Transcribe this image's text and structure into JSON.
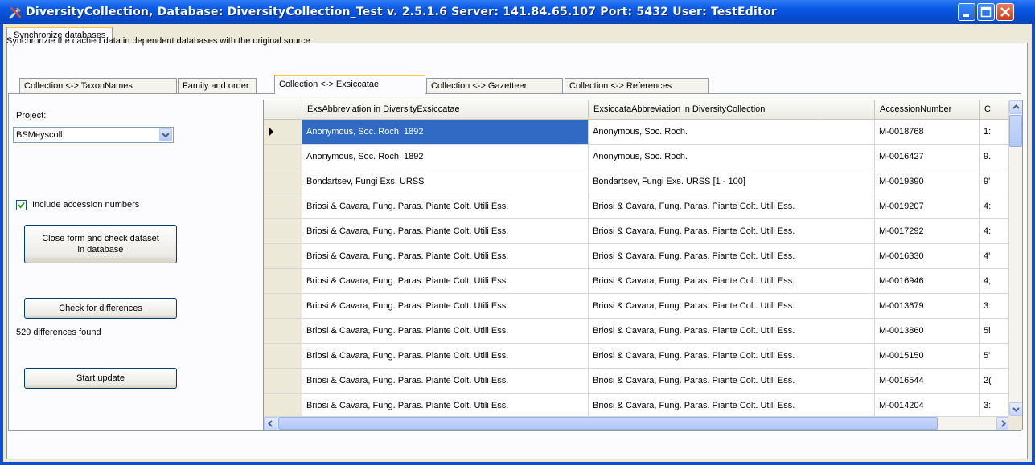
{
  "window": {
    "title": "DiversityCollection,  Database: DiversityCollection_Test   v. 2.5.1.6   Server: 141.84.65.107   Port: 5432   User: TestEditor"
  },
  "main_tab": "Synchronize databases",
  "instruction": "Synchronzie the cached data in dependent databases with the original source",
  "sub_tabs": [
    "Collection <-> TaxonNames",
    "Family and order",
    "Collection <-> Exsiccatae",
    "Collection <-> Gazetteer",
    "Collection <-> References"
  ],
  "left": {
    "project_label": "Project:",
    "project_value": "BSMeyscoll",
    "include_accession_label": "Include accession numbers",
    "include_accession_checked": true,
    "close_check_button": "Close form and check dataset in database",
    "check_diff_button": "Check for differences",
    "diff_status": "529 differences found",
    "start_update_button": "Start update"
  },
  "grid": {
    "columns": [
      "ExsAbbreviation in DiversityExsiccatae",
      "ExsiccataAbbreviation in DiversityCollection",
      "AccessionNumber",
      "C"
    ],
    "rows": [
      [
        "Anonymous, Soc. Roch. 1892",
        "Anonymous, Soc. Roch.",
        "M-0018768",
        "1:"
      ],
      [
        "Anonymous, Soc. Roch. 1892",
        "Anonymous, Soc. Roch.",
        "M-0016427",
        "9."
      ],
      [
        "Bondartsev, Fungi Exs. URSS",
        "Bondartsev, Fungi Exs. URSS [1 - 100]",
        "M-0019390",
        "9'"
      ],
      [
        "Briosi & Cavara, Fung. Paras. Piante Colt. Utili Ess.",
        "Briosi & Cavara, Fung. Paras. Piante Colt. Utili  Ess.",
        "M-0019207",
        "4:"
      ],
      [
        "Briosi & Cavara, Fung. Paras. Piante Colt. Utili Ess.",
        "Briosi & Cavara, Fung. Paras. Piante Colt. Utili  Ess.",
        "M-0017292",
        "4:"
      ],
      [
        "Briosi & Cavara, Fung. Paras. Piante Colt. Utili Ess.",
        "Briosi & Cavara, Fung. Paras. Piante Colt. Utili  Ess.",
        "M-0016330",
        "4'"
      ],
      [
        "Briosi & Cavara, Fung. Paras. Piante Colt. Utili Ess.",
        "Briosi & Cavara, Fung. Paras. Piante Colt. Utili  Ess.",
        "M-0016946",
        "4;"
      ],
      [
        "Briosi & Cavara, Fung. Paras. Piante Colt. Utili Ess.",
        "Briosi & Cavara, Fung. Paras. Piante Colt. Utili  Ess.",
        "M-0013679",
        "3:"
      ],
      [
        "Briosi & Cavara, Fung. Paras. Piante Colt. Utili Ess.",
        "Briosi & Cavara, Fung. Paras. Piante Colt. Utili  Ess.",
        "M-0013860",
        "5i"
      ],
      [
        "Briosi & Cavara, Fung. Paras. Piante Colt. Utili Ess.",
        "Briosi & Cavara, Fung. Paras. Piante Colt. Utili  Ess.",
        "M-0015150",
        "5'"
      ],
      [
        "Briosi & Cavara, Fung. Paras. Piante Colt. Utili Ess.",
        "Briosi & Cavara, Fung. Paras. Piante Colt. Utili  Ess.",
        "M-0016544",
        "2("
      ],
      [
        "Briosi & Cavara, Fung. Paras. Piante Colt. Utili Ess.",
        "Briosi & Cavara, Fung. Paras. Piante Colt. Utili  Ess.",
        "M-0014204",
        "3:"
      ]
    ],
    "selected_row": 0
  }
}
